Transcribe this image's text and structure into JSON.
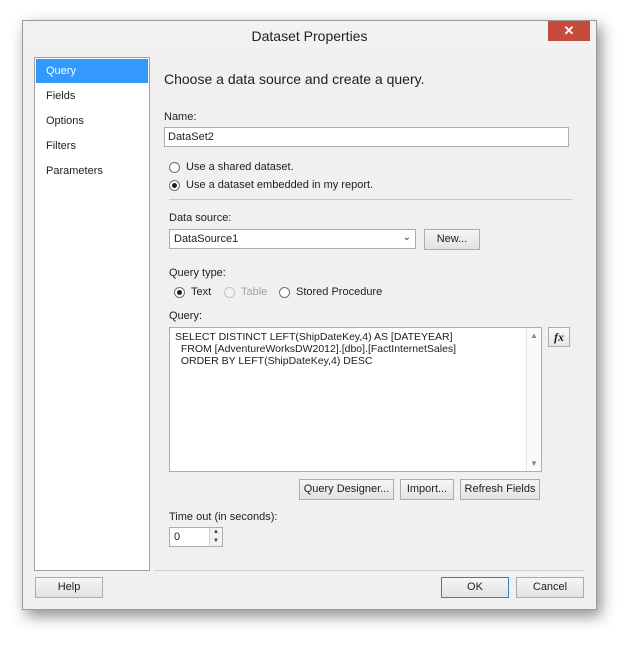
{
  "window": {
    "title": "Dataset Properties",
    "close_glyph": "✕"
  },
  "nav": {
    "items": [
      {
        "label": "Query",
        "selected": true
      },
      {
        "label": "Fields"
      },
      {
        "label": "Options"
      },
      {
        "label": "Filters"
      },
      {
        "label": "Parameters"
      }
    ]
  },
  "main": {
    "heading": "Choose a data source and create a query.",
    "name_label": "Name:",
    "name_value": "DataSet2",
    "radio_shared": "Use a shared dataset.",
    "radio_embedded": "Use a dataset embedded in my report.",
    "datasource_label": "Data source:",
    "datasource_value": "DataSource1",
    "new_button": "New...",
    "querytype_label": "Query type:",
    "querytype_text": "Text",
    "querytype_table": "Table",
    "querytype_sp": "Stored Procedure",
    "query_label": "Query:",
    "query_text": "SELECT DISTINCT LEFT(ShipDateKey,4) AS [DATEYEAR]\n  FROM [AdventureWorksDW2012].[dbo].[FactInternetSales]\n  ORDER BY LEFT(ShipDateKey,4) DESC",
    "fx_label": "fx",
    "query_designer_button": "Query Designer...",
    "import_button": "Import...",
    "refresh_button": "Refresh Fields",
    "timeout_label": "Time out (in seconds):",
    "timeout_value": "0"
  },
  "footer": {
    "help": "Help",
    "ok": "OK",
    "cancel": "Cancel"
  }
}
